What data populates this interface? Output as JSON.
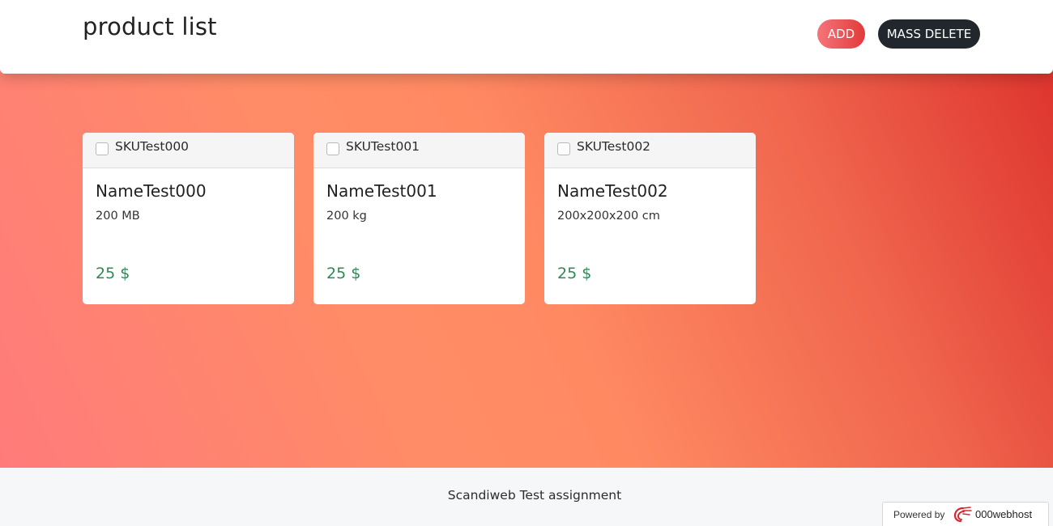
{
  "header": {
    "title": "product list",
    "add_label": "ADD",
    "mass_delete_label": "MASS DELETE"
  },
  "products": [
    {
      "sku": "SKUTest000",
      "name": "NameTest000",
      "attribute": "200 MB",
      "price": "25 $"
    },
    {
      "sku": "SKUTest001",
      "name": "NameTest001",
      "attribute": "200 kg",
      "price": "25 $"
    },
    {
      "sku": "SKUTest002",
      "name": "NameTest002",
      "attribute": "200x200x200 cm",
      "price": "25 $"
    }
  ],
  "footer": {
    "text": "Scandiweb Test assignment"
  },
  "badge": {
    "label": "Powered by",
    "brand": "000webhost",
    "icon": "000webhost-logo-icon"
  },
  "colors": {
    "add_button": "#e23a3a",
    "mass_delete_button": "#22272d",
    "price": "#2d8a57"
  }
}
